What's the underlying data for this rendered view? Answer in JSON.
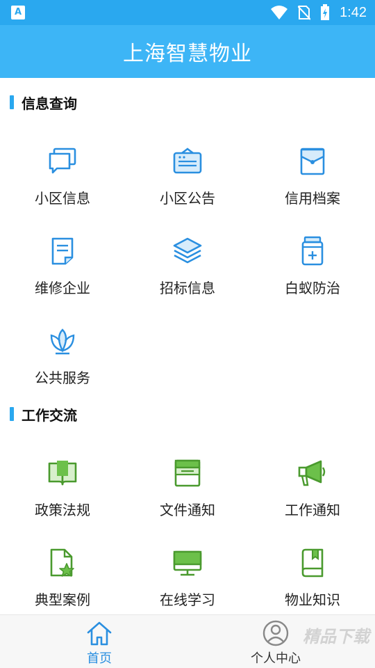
{
  "status_bar": {
    "time": "1:42",
    "app_icon_letter": "A"
  },
  "header": {
    "title": "上海智慧物业"
  },
  "sections": [
    {
      "title": "信息查询",
      "items": [
        {
          "label": "小区信息",
          "icon": "chat-bubbles-icon"
        },
        {
          "label": "小区公告",
          "icon": "notice-board-icon"
        },
        {
          "label": "信用档案",
          "icon": "file-envelope-icon"
        },
        {
          "label": "维修企业",
          "icon": "document-icon"
        },
        {
          "label": "招标信息",
          "icon": "layers-icon"
        },
        {
          "label": "白蚁防治",
          "icon": "medicine-bottle-icon"
        },
        {
          "label": "公共服务",
          "icon": "lotus-icon"
        }
      ]
    },
    {
      "title": "工作交流",
      "items": [
        {
          "label": "政策法规",
          "icon": "open-book-icon"
        },
        {
          "label": "文件通知",
          "icon": "folder-icon"
        },
        {
          "label": "工作通知",
          "icon": "megaphone-icon"
        },
        {
          "label": "典型案例",
          "icon": "starred-file-icon"
        },
        {
          "label": "在线学习",
          "icon": "monitor-icon"
        },
        {
          "label": "物业知识",
          "icon": "bookmark-book-icon"
        }
      ]
    }
  ],
  "bottom_nav": [
    {
      "label": "首页",
      "icon": "home-icon",
      "active": true
    },
    {
      "label": "个人中心",
      "icon": "person-icon",
      "active": false
    }
  ],
  "colors": {
    "primary": "#3db5f6",
    "status_bar": "#2aa8ef",
    "accent_blue": "#2a8fe0",
    "accent_green": "#6cc04a"
  },
  "watermark": "精品下载"
}
